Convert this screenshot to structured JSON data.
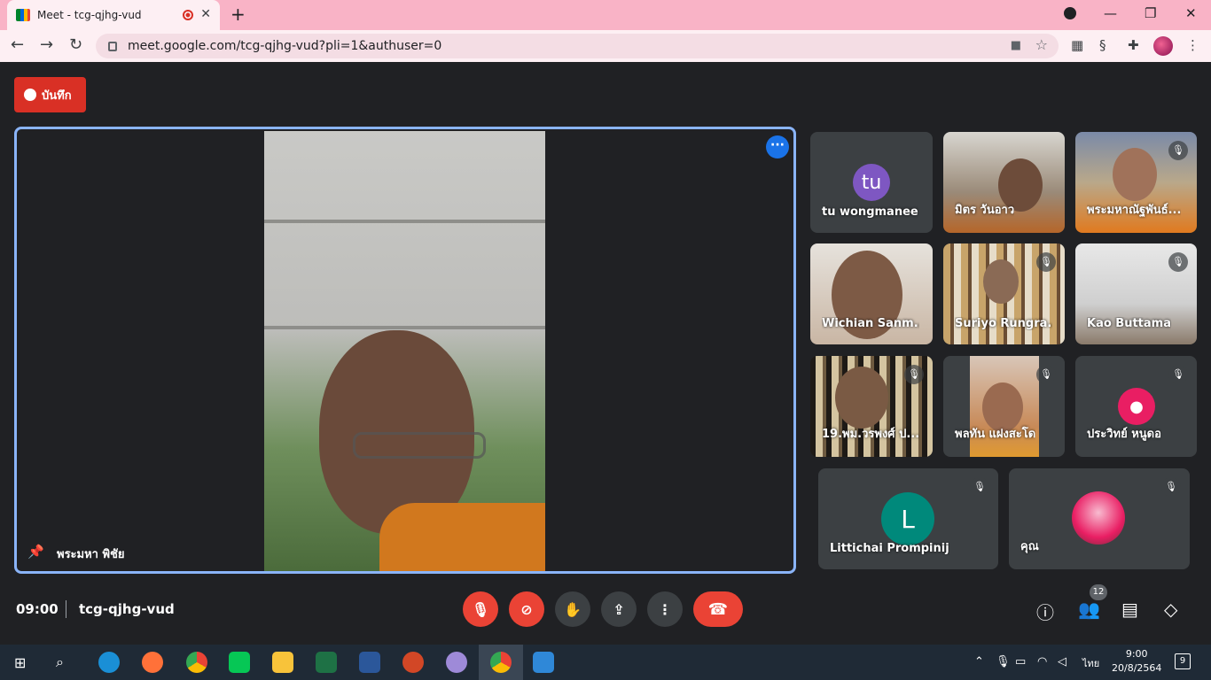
{
  "browser": {
    "tab_title": "Meet - tcg-qjhg-vud",
    "new_tab": "+",
    "url": "meet.google.com/tcg-qjhg-vud?pli=1&authuser=0"
  },
  "meet": {
    "record_label": "บันทึก",
    "main_speaker": "พระมหา พิชัย",
    "participants": [
      {
        "name": "tu wongmanee",
        "avatar": "tu",
        "avatar_color": "#7e57c2"
      },
      {
        "name": "มิตร วันอาว"
      },
      {
        "name": "พระมหาณัฐพันธ์..."
      },
      {
        "name": "Wichian Sanm..."
      },
      {
        "name": "Suriyo Rungra..."
      },
      {
        "name": "Kao Buttama"
      },
      {
        "name": "19.พม.วรพงศ์ ป...."
      },
      {
        "name": "พลทัน แฝงสะโด"
      },
      {
        "name": "ประวิทย์ หนูดอ",
        "avatar_color": "#e91e63"
      },
      {
        "name": "Littichai Prompinij",
        "avatar": "L",
        "avatar_color": "#00897b"
      },
      {
        "name": "คุณ"
      }
    ],
    "time": "09:00",
    "meeting_code": "tcg-qjhg-vud",
    "people_count": "12"
  },
  "taskbar": {
    "lang": "ไทย",
    "clock_time": "9:00",
    "clock_date": "20/8/2564",
    "notifications": "9"
  }
}
